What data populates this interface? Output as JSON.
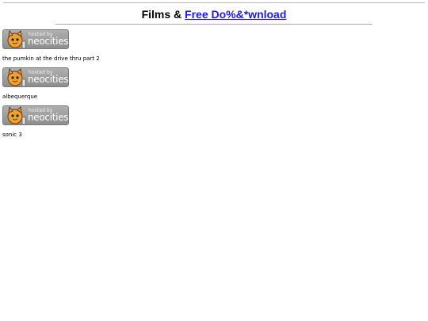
{
  "header": {
    "prefix": "Films & ",
    "link_text": "Free Do%&*wnload"
  },
  "badge": {
    "small_text": "hosted by",
    "big_text": "neocities",
    "icon": "neocities-cat-icon"
  },
  "items": [
    {
      "caption": "the pumkin at the drive thru part 2"
    },
    {
      "caption": "albequerque"
    },
    {
      "caption": "sonic 3"
    }
  ]
}
